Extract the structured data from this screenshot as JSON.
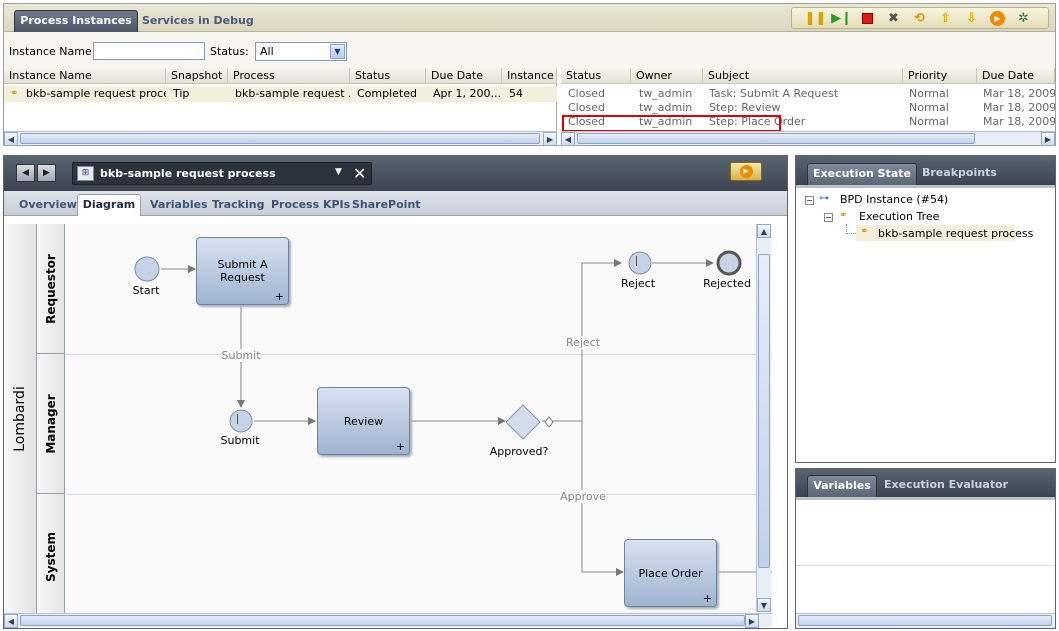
{
  "top_panel": {
    "tabs": [
      {
        "label": "Process Instances"
      },
      {
        "label": "Services in Debug"
      }
    ],
    "filter": {
      "instance_name_label": "Instance Name:",
      "instance_name_value": "",
      "status_label": "Status:",
      "status_value": "All"
    },
    "instances_table": {
      "columns": [
        "Instance Name",
        "Snapshot",
        "Process",
        "Status",
        "Due Date",
        "Instance I"
      ],
      "rows": [
        {
          "name": "bkb-sample request proce...",
          "snapshot": "Tip",
          "process": "bkb-sample request ...",
          "status": "Completed",
          "due": "Apr 1, 200...",
          "id": "54"
        }
      ]
    },
    "tasks_table": {
      "columns": [
        "Status",
        "Owner",
        "Subject",
        "Priority",
        "Due Date"
      ],
      "rows": [
        {
          "status": "Closed",
          "owner": "tw_admin",
          "subject": "Task: Submit A Request",
          "priority": "Normal",
          "due": "Mar 18, 2009"
        },
        {
          "status": "Closed",
          "owner": "tw_admin",
          "subject": "Step: Review",
          "priority": "Normal",
          "due": "Mar 18, 2009"
        },
        {
          "status": "Closed",
          "owner": "tw_admin",
          "subject": "Step: Place Order",
          "priority": "Normal",
          "due": "Mar 18, 2009"
        }
      ]
    },
    "toolbar_icons": [
      "pause-icon",
      "step-icon",
      "stop-icon",
      "close-icon",
      "refresh-icon",
      "arrow-up-icon",
      "arrow-down-icon",
      "run-icon",
      "debug-icon"
    ]
  },
  "process_panel": {
    "title": "bkb-sample request process",
    "tabs": [
      {
        "label": "Overview"
      },
      {
        "label": "Diagram"
      },
      {
        "label": "Variables"
      },
      {
        "label": "Tracking"
      },
      {
        "label": "Process KPIs"
      },
      {
        "label": "SharePoint"
      }
    ],
    "pool": "Lombardi",
    "lanes": [
      "Requestor",
      "Manager",
      "System"
    ],
    "nodes": {
      "start": "Start",
      "submit_task": "Submit A Request",
      "submit_event": "Submit",
      "review": "Review",
      "gateway": "Approved?",
      "reject_event": "Reject",
      "rejected_end": "Rejected",
      "place_order": "Place Order"
    },
    "flows": {
      "submit": "Submit",
      "reject": "Reject",
      "approve": "Approve"
    }
  },
  "execution_state": {
    "tabs": [
      {
        "label": "Execution State"
      },
      {
        "label": "Breakpoints"
      }
    ],
    "tree": {
      "bpd": "BPD Instance (#54)",
      "exec_tree": "Execution Tree",
      "process": "bkb-sample request process"
    }
  },
  "variables_panel": {
    "tabs": [
      {
        "label": "Variables"
      },
      {
        "label": "Execution Evaluator"
      }
    ]
  },
  "colors": {
    "accent": "#4b5666",
    "highlight": "#e00000",
    "selected_row": "#f2efdc"
  }
}
